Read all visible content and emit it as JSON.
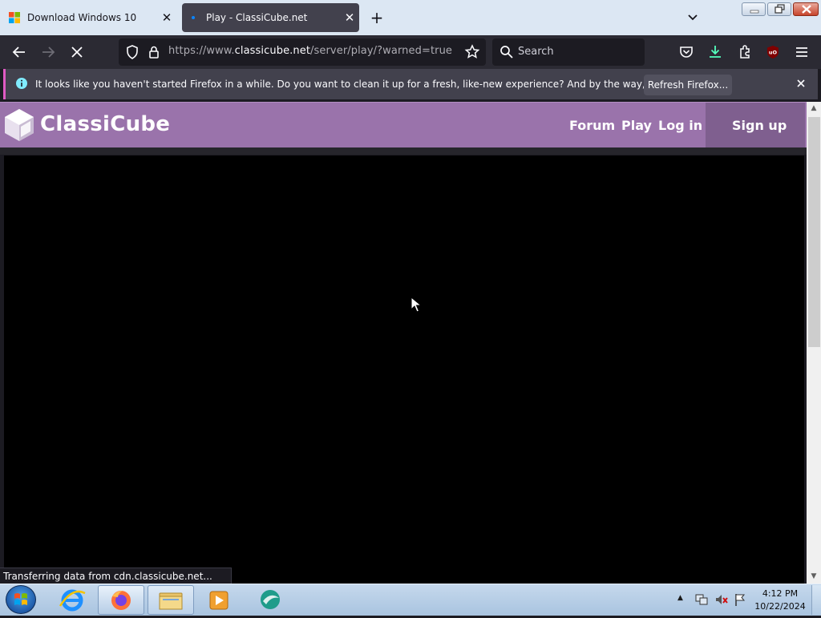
{
  "tabs": [
    {
      "title": "Download Windows 10",
      "active": false,
      "favicon": "windows-logo-icon"
    },
    {
      "title": "Play - ClassiCube.net",
      "active": true,
      "favicon": "loading-dot-icon"
    }
  ],
  "navbar": {
    "url_prefix": "https://www.",
    "url_domain": "classicube.net",
    "url_path": "/server/play/?warned=true",
    "search_placeholder": "Search"
  },
  "notification": {
    "text": "It looks like you haven't started Firefox in a while. Do you want to clean it up for a fresh, like-new experience? And by the way, welcome back!",
    "button_label": "Refresh Firefox..."
  },
  "site": {
    "logo_text": "ClassiCube",
    "nav": {
      "forum": "Forum",
      "play": "Play",
      "login": "Log in",
      "signup": "Sign up"
    },
    "header_color": "#9a73ab"
  },
  "status_text": "Transferring data from cdn.classicube.net...",
  "taskbar": {
    "time": "4:12 PM",
    "date": "10/22/2024",
    "items": [
      "internet-explorer-icon",
      "firefox-icon",
      "file-explorer-icon",
      "media-player-icon",
      "app-icon"
    ]
  }
}
